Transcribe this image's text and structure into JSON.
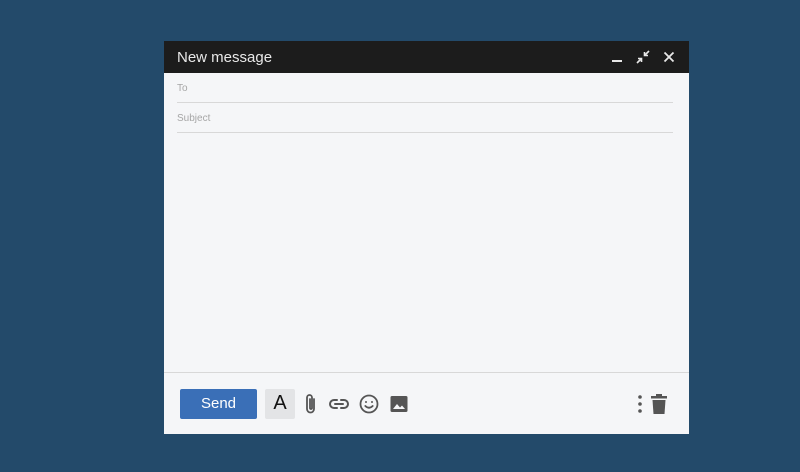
{
  "window": {
    "title": "New message",
    "minimize_icon": "minimize-icon",
    "exit_fullscreen_icon": "exit-fullscreen-icon",
    "close_icon": "close-icon"
  },
  "fields": {
    "to_placeholder": "To",
    "subject_placeholder": "Subject"
  },
  "footer": {
    "send_label": "Send",
    "format_label": "A",
    "tools": [
      "attach-file-icon",
      "insert-link-icon",
      "insert-emoji-icon",
      "insert-photo-icon"
    ],
    "more_options_icon": "more-options-icon",
    "discard_icon": "trash-icon"
  },
  "colors": {
    "background": "#234a6a",
    "titlebar": "#1c1c1c",
    "panel": "#f5f6f8",
    "send_button": "#3a6fb7"
  }
}
